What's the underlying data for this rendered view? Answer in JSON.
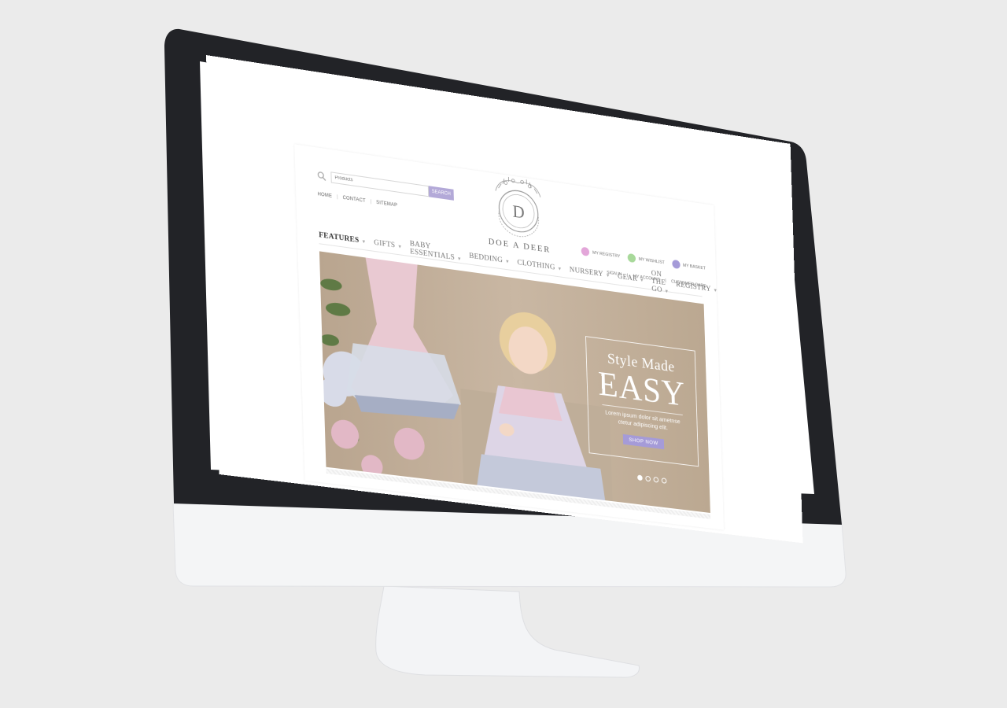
{
  "site": {
    "brand": "DOE A DEER",
    "logo_letter": "D",
    "search": {
      "placeholder": "Products",
      "button": "SEARCH"
    },
    "top_links": [
      "HOME",
      "CONTACT",
      "SITEMAP"
    ],
    "account_links": [
      {
        "label": "MY REGISTRY",
        "color": "#e3a6d9",
        "icon": "registry-icon"
      },
      {
        "label": "MY WISHLIST",
        "color": "#a8d99a",
        "icon": "wishlist-icon"
      },
      {
        "label": "MY BASKET",
        "color": "#a59bd8",
        "icon": "basket-icon"
      }
    ],
    "sub_links": [
      "SIGN IN",
      "MY ACCOUNT",
      "CUSTOMER CARE"
    ],
    "nav": [
      "FEATURES",
      "GIFTS",
      "BABY ESSENTIALS",
      "BEDDING",
      "CLOTHING",
      "NURSERY",
      "GEAR",
      "ON THE GO",
      "REGISTRY"
    ],
    "hero": {
      "title_line1": "Style Made",
      "title_line2": "EASY",
      "body": "Lorem ipsum dolor sit ametnse ctetur adipiscing elit.",
      "cta": "SHOP NOW",
      "slides": 4,
      "active_slide": 1
    }
  },
  "colors": {
    "accent": "#a59bd8",
    "monitor_bezel": "#222327",
    "monitor_chin": "#f4f5f6"
  }
}
